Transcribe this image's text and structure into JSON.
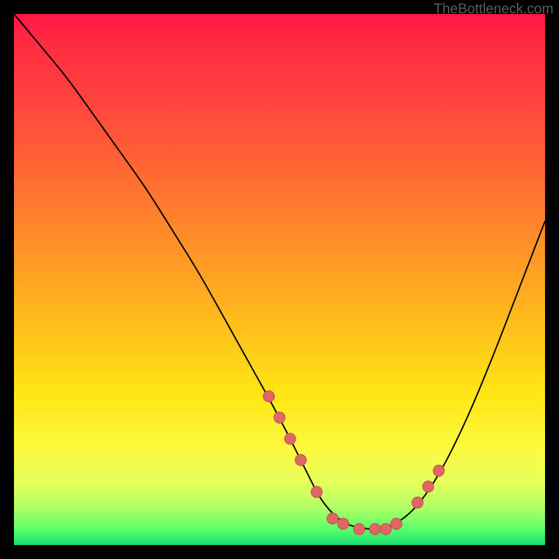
{
  "watermark": "TheBottleneck.com",
  "chart_data": {
    "type": "line",
    "title": "",
    "xlabel": "",
    "ylabel": "",
    "xlim": [
      0,
      100
    ],
    "ylim": [
      0,
      100
    ],
    "curve": {
      "x": [
        0,
        5,
        10,
        15,
        20,
        25,
        30,
        35,
        40,
        45,
        50,
        55,
        58,
        62,
        66,
        70,
        75,
        80,
        85,
        90,
        95,
        100
      ],
      "y": [
        100,
        94,
        88,
        81,
        74,
        67,
        59,
        51,
        42,
        33,
        24,
        14,
        8,
        4,
        3,
        3,
        6,
        13,
        23,
        35,
        48,
        61
      ]
    },
    "markers": {
      "x": [
        48,
        50,
        52,
        54,
        57,
        60,
        62,
        65,
        68,
        70,
        72,
        76,
        78,
        80
      ],
      "y": [
        28,
        24,
        20,
        16,
        10,
        5,
        4,
        3,
        3,
        3,
        4,
        8,
        11,
        14
      ]
    },
    "colors": {
      "curve": "#000000",
      "marker_fill": "#e06666",
      "marker_stroke": "#c04d4d"
    }
  }
}
